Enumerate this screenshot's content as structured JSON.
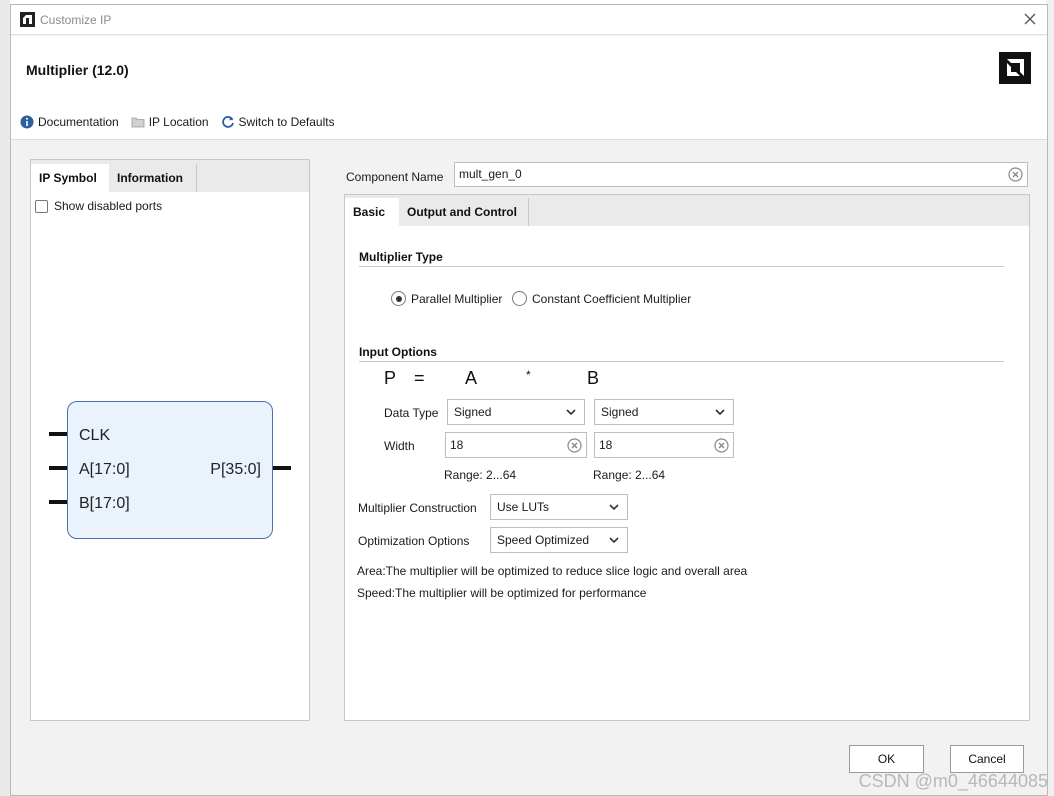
{
  "window": {
    "title": "Customize IP"
  },
  "header": {
    "ip_title": "Multiplier (12.0)",
    "toolbar": [
      {
        "label": "Documentation",
        "icon": "info-icon"
      },
      {
        "label": "IP Location",
        "icon": "folder-icon"
      },
      {
        "label": "Switch to Defaults",
        "icon": "refresh-icon"
      }
    ]
  },
  "left_panel": {
    "tabs": [
      "IP Symbol",
      "Information"
    ],
    "active_tab": "IP Symbol",
    "show_disabled_ports": {
      "label": "Show disabled ports",
      "checked": false
    },
    "symbol": {
      "inputs": [
        "CLK",
        "A[17:0]",
        "B[17:0]"
      ],
      "outputs": [
        "P[35:0]"
      ]
    }
  },
  "component_name": {
    "label": "Component Name",
    "value": "mult_gen_0"
  },
  "right_panel": {
    "tabs": [
      "Basic",
      "Output and Control"
    ],
    "active_tab": "Basic",
    "multiplier_type": {
      "title": "Multiplier Type",
      "options": [
        "Parallel Multiplier",
        "Constant Coefficient Multiplier"
      ],
      "selected": "Parallel Multiplier"
    },
    "input_options": {
      "title": "Input Options",
      "formula": {
        "p": "P",
        "eq": "=",
        "a": "A",
        "op": "*",
        "b": "B"
      },
      "data_type_label": "Data Type",
      "data_type_a": "Signed",
      "data_type_b": "Signed",
      "width_label": "Width",
      "width_a": "18",
      "width_b": "18",
      "range_a": "Range: 2...64",
      "range_b": "Range: 2...64"
    },
    "construction": {
      "label": "Multiplier Construction",
      "value": "Use LUTs"
    },
    "optimization": {
      "label": "Optimization Options",
      "value": "Speed Optimized"
    },
    "notes": [
      "Area:The multiplier will be optimized to reduce slice logic and overall area",
      "Speed:The multiplier will be optimized for performance"
    ]
  },
  "buttons": {
    "ok": "OK",
    "cancel": "Cancel"
  },
  "watermark": "CSDN @m0_46644085"
}
